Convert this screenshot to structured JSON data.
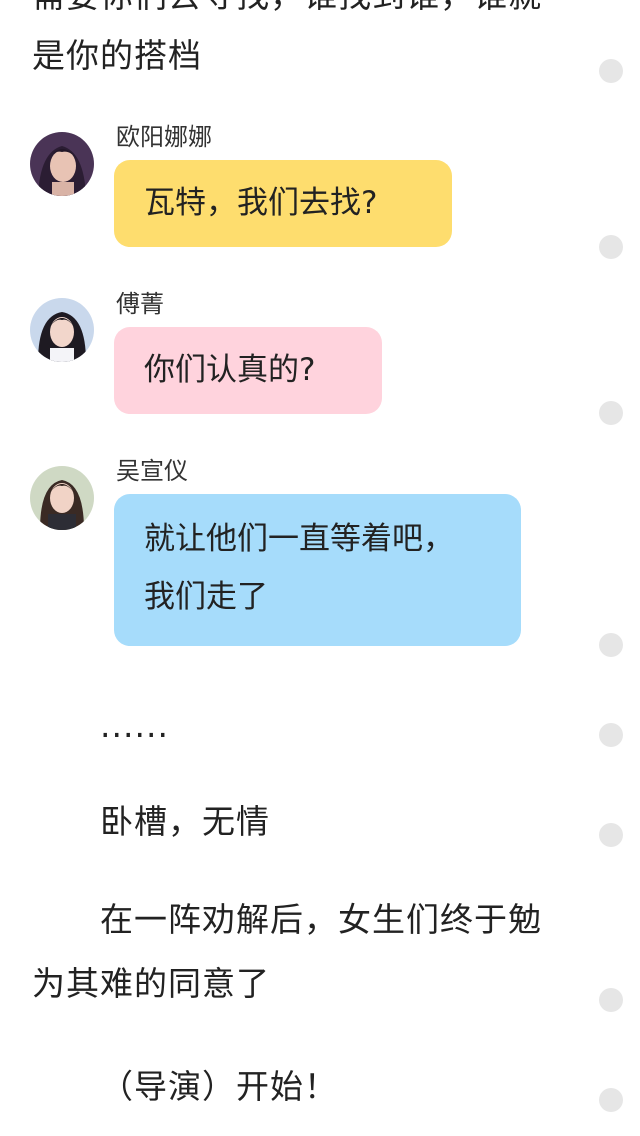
{
  "story": {
    "cut_top_line": "需要你们去寻找，谁找到谁，谁就",
    "intro_line": "是你的搭档"
  },
  "chat": [
    {
      "speaker": "欧阳娜娜",
      "avatar_icon": "avatar-ouyang-nana",
      "bubble_color": "#fedd6e",
      "lines": [
        "瓦特，我们去找?"
      ]
    },
    {
      "speaker": "傅菁",
      "avatar_icon": "avatar-fu-jing",
      "bubble_color": "#ffd3dd",
      "lines": [
        "你们认真的?"
      ]
    },
    {
      "speaker": "吴宣仪",
      "avatar_icon": "avatar-wu-xuanyi",
      "bubble_color": "#a6dcfb",
      "lines": [
        "就让他们一直等着吧，",
        "我们走了"
      ]
    }
  ],
  "paragraphs": {
    "ellipsis": "......",
    "p1": "卧槽，无情",
    "p2": "在一阵劝解后，女生们终于勉为其难的同意了",
    "p3": "（导演）开始！"
  },
  "side_dots_icon": "comment-dot-icon"
}
